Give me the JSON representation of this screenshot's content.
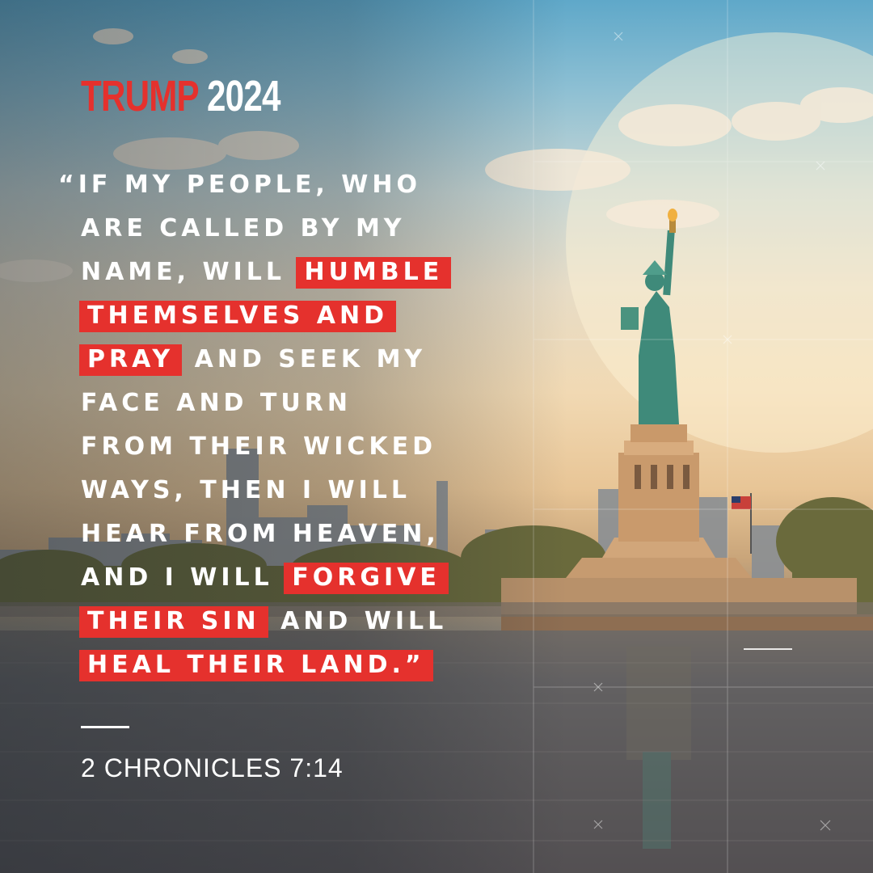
{
  "brand": {
    "name": "TRUMP",
    "year": "2024"
  },
  "quote": {
    "lines": [
      [
        {
          "t": "“IF MY PEOPLE, WHO",
          "h": false
        }
      ],
      [
        {
          "t": "ARE CALLED BY MY",
          "h": false
        }
      ],
      [
        {
          "t": "NAME, WILL ",
          "h": false
        },
        {
          "t": "HUMBLE",
          "h": true
        }
      ],
      [
        {
          "t": "THEMSELVES AND",
          "h": true
        }
      ],
      [
        {
          "t": "PRAY",
          "h": true
        },
        {
          "t": " AND SEEK MY",
          "h": false
        }
      ],
      [
        {
          "t": "FACE AND TURN",
          "h": false
        }
      ],
      [
        {
          "t": "FROM THEIR WICKED",
          "h": false
        }
      ],
      [
        {
          "t": "WAYS, THEN I WILL",
          "h": false
        }
      ],
      [
        {
          "t": "HEAR FROM HEAVEN,",
          "h": false
        }
      ],
      [
        {
          "t": "AND I WILL ",
          "h": false
        },
        {
          "t": "FORGIVE",
          "h": true
        }
      ],
      [
        {
          "t": "THEIR SIN",
          "h": true
        },
        {
          "t": " AND WILL",
          "h": false
        }
      ],
      [
        {
          "t": "HEAL THEIR LAND.”",
          "h": true
        }
      ]
    ]
  },
  "reference": "2 CHRONICLES 7:14",
  "colors": {
    "accent": "#e5312d",
    "text": "#ffffff"
  },
  "background": {
    "subject": "statue-of-liberty-harbor-scene"
  }
}
